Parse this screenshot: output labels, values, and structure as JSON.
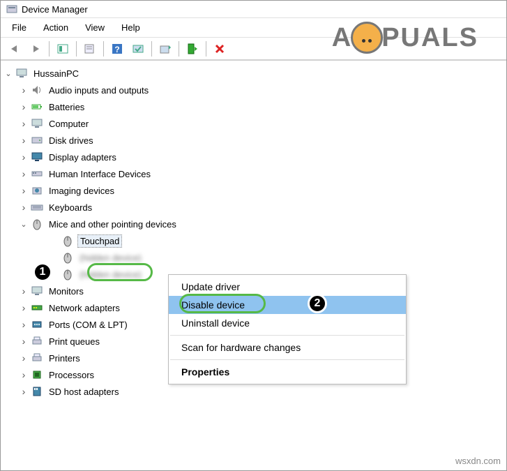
{
  "window": {
    "title": "Device Manager"
  },
  "menubar": [
    "File",
    "Action",
    "View",
    "Help"
  ],
  "toolbar_icons": [
    "back",
    "forward",
    "sep",
    "properties",
    "details",
    "help",
    "scan",
    "sep",
    "update",
    "uninstall",
    "disable"
  ],
  "tree": {
    "root": "HussainPC",
    "items": [
      {
        "label": "Audio inputs and outputs",
        "icon": "speaker"
      },
      {
        "label": "Batteries",
        "icon": "battery"
      },
      {
        "label": "Computer",
        "icon": "computer"
      },
      {
        "label": "Disk drives",
        "icon": "disk"
      },
      {
        "label": "Display adapters",
        "icon": "display"
      },
      {
        "label": "Human Interface Devices",
        "icon": "hid"
      },
      {
        "label": "Imaging devices",
        "icon": "camera"
      },
      {
        "label": "Keyboards",
        "icon": "keyboard"
      }
    ],
    "expanded": {
      "label": "Mice and other pointing devices",
      "icon": "mouse",
      "children": [
        {
          "label": "Touchpad",
          "icon": "mouse",
          "selected": true,
          "highlighted": true
        },
        {
          "label": "(hidden device)",
          "icon": "mouse",
          "blurred": true
        },
        {
          "label": "(hidden device)",
          "icon": "mouse",
          "blurred": true
        }
      ]
    },
    "items2": [
      {
        "label": "Monitors",
        "icon": "monitor"
      },
      {
        "label": "Network adapters",
        "icon": "network"
      },
      {
        "label": "Ports (COM & LPT)",
        "icon": "port"
      },
      {
        "label": "Print queues",
        "icon": "printer"
      },
      {
        "label": "Printers",
        "icon": "printer"
      },
      {
        "label": "Processors",
        "icon": "cpu"
      },
      {
        "label": "SD host adapters",
        "icon": "sd"
      }
    ]
  },
  "context_menu": {
    "items": [
      {
        "label": "Update driver"
      },
      {
        "label": "Disable device",
        "highlight": true
      },
      {
        "label": "Uninstall device"
      },
      {
        "sep": true
      },
      {
        "label": "Scan for hardware changes"
      },
      {
        "sep": true
      },
      {
        "label": "Properties",
        "bold": true
      }
    ]
  },
  "annotations": {
    "badge1": "1",
    "badge2": "2"
  },
  "watermark": {
    "brand_left": "A",
    "brand_right": "PUALS",
    "footer": "wsxdn.com"
  }
}
